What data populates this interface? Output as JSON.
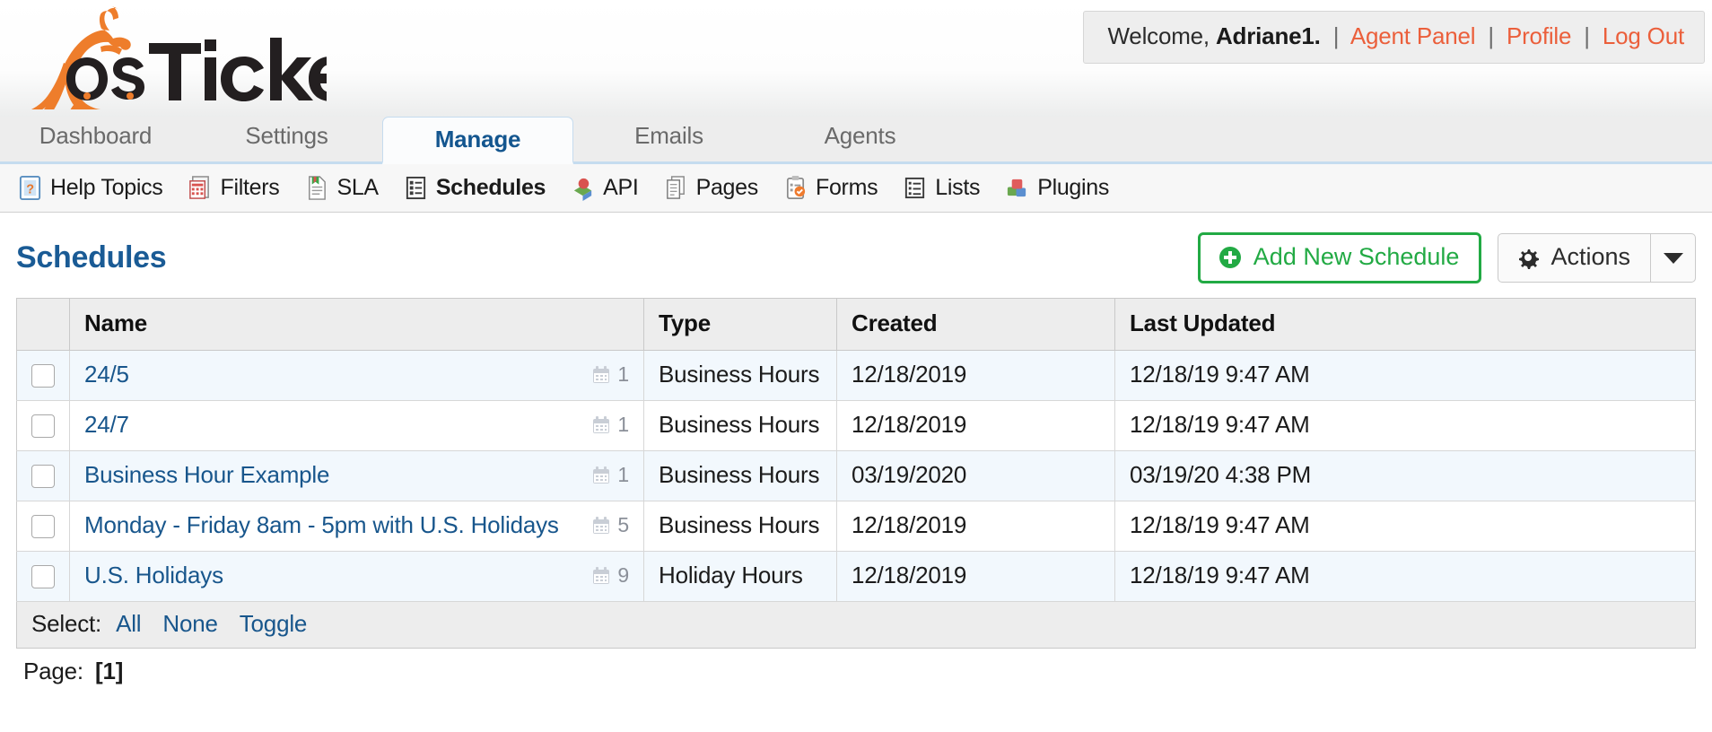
{
  "header": {
    "logo_alt": "osTicket",
    "welcome_prefix": "Welcome,",
    "username": "Adriane1.",
    "links": [
      {
        "label": "Agent Panel"
      },
      {
        "label": "Profile"
      },
      {
        "label": "Log Out"
      }
    ],
    "separator": "|"
  },
  "tabs": [
    {
      "label": "Dashboard",
      "active": false
    },
    {
      "label": "Settings",
      "active": false
    },
    {
      "label": "Manage",
      "active": true
    },
    {
      "label": "Emails",
      "active": false
    },
    {
      "label": "Agents",
      "active": false
    }
  ],
  "subnav": [
    {
      "label": "Help Topics",
      "icon": "help-topics-icon",
      "active": false
    },
    {
      "label": "Filters",
      "icon": "filters-icon",
      "active": false
    },
    {
      "label": "SLA",
      "icon": "sla-icon",
      "active": false
    },
    {
      "label": "Schedules",
      "icon": "schedules-icon",
      "active": true
    },
    {
      "label": "API",
      "icon": "api-icon",
      "active": false
    },
    {
      "label": "Pages",
      "icon": "pages-icon",
      "active": false
    },
    {
      "label": "Forms",
      "icon": "forms-icon",
      "active": false
    },
    {
      "label": "Lists",
      "icon": "lists-icon",
      "active": false
    },
    {
      "label": "Plugins",
      "icon": "plugins-icon",
      "active": false
    }
  ],
  "page": {
    "title": "Schedules",
    "add_button": "Add New Schedule",
    "actions_button": "Actions"
  },
  "table": {
    "columns": [
      "Name",
      "Type",
      "Created",
      "Last Updated"
    ],
    "rows": [
      {
        "name": "24/5",
        "count": "1",
        "type": "Business Hours",
        "created": "12/18/2019",
        "updated": "12/18/19 9:47 AM"
      },
      {
        "name": "24/7",
        "count": "1",
        "type": "Business Hours",
        "created": "12/18/2019",
        "updated": "12/18/19 9:47 AM"
      },
      {
        "name": "Business Hour Example",
        "count": "1",
        "type": "Business Hours",
        "created": "03/19/2020",
        "updated": "03/19/20 4:38 PM"
      },
      {
        "name": "Monday - Friday 8am - 5pm with U.S. Holidays",
        "count": "5",
        "type": "Business Hours",
        "created": "12/18/2019",
        "updated": "12/18/19 9:47 AM"
      },
      {
        "name": "U.S. Holidays",
        "count": "9",
        "type": "Holiday Hours",
        "created": "12/18/2019",
        "updated": "12/18/19 9:47 AM"
      }
    ]
  },
  "footer": {
    "select_label": "Select:",
    "select_all": "All",
    "select_none": "None",
    "select_toggle": "Toggle",
    "page_label": "Page:",
    "page_value": "[1]"
  },
  "colors": {
    "brand_orange": "#ee7d2b",
    "link_orange": "#eb5f3b",
    "title_blue": "#1a5b95",
    "link_blue": "#18568c",
    "green": "#22aa44",
    "row_alt": "#f2f8fd"
  }
}
